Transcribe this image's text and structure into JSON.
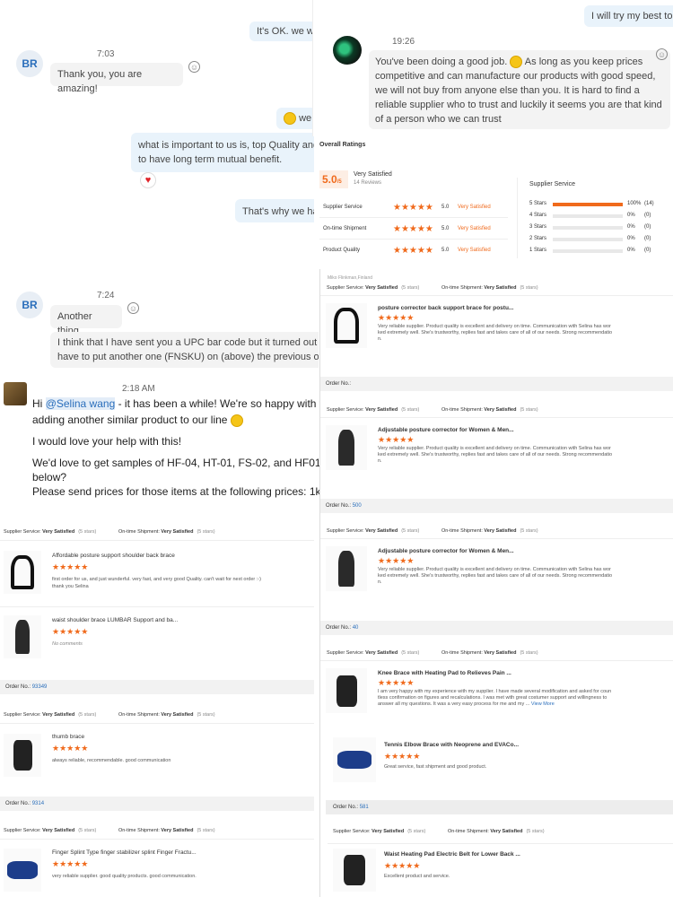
{
  "chat_left": {
    "msg_top": "It's OK. we wi",
    "br_initials": "BR",
    "time1": "7:03",
    "thanks": "Thank you, you are amazing!",
    "we_partial": "we",
    "important": "what is important to us is, top Quality and I",
    "long_term": "to have long term mutual benefit.",
    "thats_why": "That's why we ha",
    "time2": "7:24",
    "another": "Another thing",
    "upc1": "I think that I have sent you a UPC bar code but it turned out that",
    "upc2": "have to put another one (FNSKU) on (above) the previous one."
  },
  "chat_right": {
    "reply_top": "I will try my best to s",
    "time": "19:26",
    "good_job1": "You've been doing a good job.",
    "good_job1b": "As long as you keep prices",
    "good_job2": "competitive and can manufacture our products with good speed,",
    "good_job3": "we will not buy from anyone else than you. It is hard to find a",
    "good_job4": "reliable supplier who to trust and luckily it seems you are that kind",
    "good_job5": "of a person who we can trust"
  },
  "email": {
    "time": "2:18 AM",
    "hi": "Hi",
    "mention": "@Selina wang",
    "line1_rest": "- it has been a while! We're so happy with the s",
    "line2": "adding another similar product to our line",
    "line3": "I would love your help with this!",
    "line4": "We'd love to get samples of HF-04, HT-01, FS-02, and HF01. Wi",
    "line5": "below?",
    "line6": "Please send prices for those items at the following prices: 1k unit"
  },
  "ratings": {
    "title": "Overall Ratings",
    "score": "5.0",
    "score_den": "/5",
    "very_satisfied": "Very Satisfied",
    "reviews": "14 Reviews",
    "supplier_service_label": "Supplier Service",
    "rows": [
      {
        "label": "Supplier Service",
        "score": "5.0",
        "status": "Very Satisfied"
      },
      {
        "label": "On-time Shipment",
        "score": "5.0",
        "status": "Very Satisfied"
      },
      {
        "label": "Product Quality",
        "score": "5.0",
        "status": "Very Satisfied"
      }
    ],
    "breakdown": [
      {
        "label": "5 Stars",
        "pct": "100%",
        "count": "(14)",
        "fill": 1.0
      },
      {
        "label": "4 Stars",
        "pct": "0%",
        "count": "(0)",
        "fill": 0
      },
      {
        "label": "3 Stars",
        "pct": "0%",
        "count": "(0)",
        "fill": 0
      },
      {
        "label": "2 Stars",
        "pct": "0%",
        "count": "(0)",
        "fill": 0
      },
      {
        "label": "1 Stars",
        "pct": "0%",
        "count": "(0)",
        "fill": 0
      }
    ]
  },
  "reviews_right": {
    "reviewer": "Miko Flinkman,Finland",
    "ss_label": "Supplier Service:",
    "vs": "Very Satisfied",
    "stars5": "(5 stars)",
    "ots_label": "On-time Shipment:",
    "order_label": "Order No.:",
    "items": [
      {
        "title": "posture corrector back support brace for postu...",
        "text1": "Very reliable supplier. Product quality is excellent and delivery on time. Communication with Selina has wor",
        "text2": "ked extremely well. She's trustworthy, replies fast and takes care of all of our needs. Strong recommendatio",
        "text3": "n.",
        "order": ""
      },
      {
        "title": "Adjustable posture corrector for Women & Men...",
        "text1": "Very reliable supplier. Product quality is excellent and delivery on time. Communication with Selina has wor",
        "text2": "ked extremely well. She's trustworthy, replies fast and takes care of all of our needs. Strong recommendatio",
        "text3": "n.",
        "order": "500"
      },
      {
        "title": "Adjustable posture corrector for Women & Men...",
        "text1": "Very reliable supplier. Product quality is excellent and delivery on time. Communication with Selina has wor",
        "text2": "ked extremely well. She's trustworthy, replies fast and takes care of all of our needs. Strong recommendatio",
        "text3": "n.",
        "order": "40"
      },
      {
        "title": "Knee Brace with Heating Pad to Relieves Pain ...",
        "text1": "I am very happy with my experience with my supplier. I have made several modification and asked for coun",
        "text2": "tless confirmation on figures and recalculations. I was met with great costumer support and willingness to",
        "text3": "answer all my questions. It was a very easy process for me and my ... ",
        "more": "View More",
        "order": ""
      }
    ],
    "tennis_title": "Tennis Elbow Brace with Neoprene and EVACo...",
    "tennis_text": "Great service, fast shipment and good product.",
    "order_581": "581",
    "waist_title": "Waist Heating Pad Electric Belt for Lower Back ...",
    "waist_text": "Excellent product and service."
  },
  "reviews_left": {
    "ss_label": "Supplier Service:",
    "vs": "Very Satisfied",
    "stars5": "(5 stars)",
    "ots_label": "On-time Shipment:",
    "order_label": "Order No.:",
    "items": [
      {
        "title": "Affordable posture support shoulder back brace",
        "text1": "first order for us, and just wunderful. very fast, and very good Quality. can't wait for next order :-)",
        "text2": "thank you Selina"
      },
      {
        "title": "waist shoulder brace LUMBAR Support and ba...",
        "text1": "No comments",
        "text2": ""
      }
    ],
    "order1": "93349",
    "thumb_title": "thumb brace",
    "thumb_text": "always reliable, recommendable. good communication",
    "order2": "9314",
    "finger_title": "Finger Splint Type finger stabilizer splint Finger Fractu...",
    "finger_text": "very reliable supplier. good quality products. good communication."
  },
  "stars_text": "★★★★★",
  "colors": {
    "accent": "#f06a1c",
    "link": "#2a6ebb",
    "bubble": "#e9f3fb"
  }
}
